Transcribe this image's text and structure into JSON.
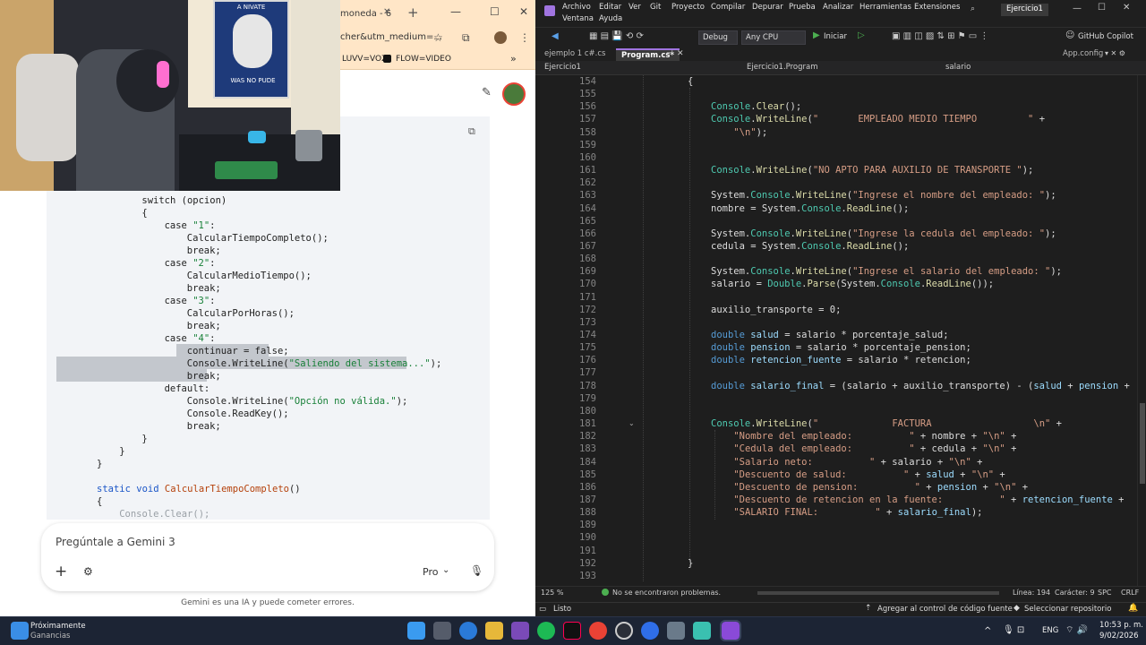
{
  "browser": {
    "tab_title": "moneda - 6",
    "url_fragment": "cher&utm_medium=...",
    "bookmarks": [
      "LUVV=VOZ",
      "FLOW=VIDEO"
    ],
    "gemini": {
      "prompt_placeholder": "Pregúntale a Gemini 3",
      "model_label": "Pro",
      "disclaimer": "Gemini es una IA y puede cometer errores."
    },
    "code_lines": [
      {
        "indent": 8,
        "text": "switch (opcion)"
      },
      {
        "indent": 8,
        "text": "{"
      },
      {
        "indent": 12,
        "text": "case \"1\":"
      },
      {
        "indent": 16,
        "text": "CalcularTiempoCompleto();"
      },
      {
        "indent": 16,
        "text": "break;"
      },
      {
        "indent": 12,
        "text": "case \"2\":"
      },
      {
        "indent": 16,
        "text": "CalcularMedioTiempo();"
      },
      {
        "indent": 16,
        "text": "break;"
      },
      {
        "indent": 12,
        "text": "case \"3\":"
      },
      {
        "indent": 16,
        "text": "CalcularPorHoras();"
      },
      {
        "indent": 16,
        "text": "break;"
      },
      {
        "indent": 12,
        "text": "case \"4\":"
      },
      {
        "indent": 16,
        "text": "continuar = false;"
      },
      {
        "indent": 16,
        "text": "Console.WriteLine(\"Saliendo del sistema...\");"
      },
      {
        "indent": 16,
        "text": "break;"
      },
      {
        "indent": 12,
        "text": "default:"
      },
      {
        "indent": 16,
        "text": "Console.WriteLine(\"Opción no válida.\");"
      },
      {
        "indent": 16,
        "text": "Console.ReadKey();"
      },
      {
        "indent": 16,
        "text": "break;"
      },
      {
        "indent": 8,
        "text": "}"
      },
      {
        "indent": 4,
        "text": "}"
      },
      {
        "indent": 0,
        "text": "}"
      },
      {
        "indent": 0,
        "text": ""
      },
      {
        "indent": 0,
        "text": "static void CalcularTiempoCompleto()"
      },
      {
        "indent": 0,
        "text": "{"
      },
      {
        "indent": 4,
        "text": "Console.Clear();"
      }
    ],
    "webcam_poster_text": [
      "A NIVATE",
      "WAS NO PUDE"
    ]
  },
  "vs": {
    "menu": [
      "Archivo",
      "Editar",
      "Ver",
      "Git",
      "Proyecto",
      "Compilar",
      "Depurar",
      "Prueba",
      "Analizar",
      "Herramientas",
      "Extensiones",
      "Ventana",
      "Ayuda"
    ],
    "solution_name": "Ejercicio1",
    "config": "Debug",
    "platform": "Any CPU",
    "run_label": "Iniciar",
    "copilot_label": "GitHub Copilot",
    "tabs": [
      "ejemplo 1 c#.cs",
      "Program.cs*",
      "App.config"
    ],
    "nav": {
      "project": "Ejercicio1",
      "class": "Ejercicio1.Program",
      "member": "salario"
    },
    "line_numbers": [
      "154",
      "155",
      "156",
      "157",
      "158",
      "159",
      "160",
      "161",
      "162",
      "163",
      "164",
      "165",
      "166",
      "167",
      "168",
      "169",
      "170",
      "171",
      "172",
      "173",
      "174",
      "175",
      "176",
      "177",
      "178",
      "179",
      "180",
      "181",
      "182",
      "183",
      "184",
      "185",
      "186",
      "187",
      "188",
      "189",
      "190",
      "191",
      "192",
      "193"
    ],
    "code": [
      "{",
      "",
      "Console.Clear();",
      "Console.WriteLine(\"       EMPLEADO MEDIO TIEMPO         \" +",
      "    \"\\n\");",
      "",
      "",
      "Console.WriteLine(\"NO APTO PARA AUXILIO DE TRANSPORTE \");",
      "",
      "System.Console.WriteLine(\"Ingrese el nombre del empleado: \");",
      "nombre = System.Console.ReadLine();",
      "",
      "System.Console.WriteLine(\"Ingrese la cedula del empleado: \");",
      "cedula = System.Console.ReadLine();",
      "",
      "System.Console.WriteLine(\"Ingrese el salario del empleado: \");",
      "salario = Double.Parse(System.Console.ReadLine());",
      "",
      "auxilio_transporte = 0;",
      "",
      "double salud = salario * porcentaje_salud;",
      "double pension = salario * porcentaje_pension;",
      "double retencion_fuente = salario * retencion;",
      "",
      "double salario_final = (salario + auxilio_transporte) - (salud + pension +",
      "",
      "",
      "Console.WriteLine(\"             FACTURA                  \\n\" +",
      "    \"Nombre del empleado:          \" + nombre + \"\\n\" +",
      "    \"Cedula del empleado:          \" + cedula + \"\\n\" +",
      "    \"Salario neto:          \" + salario + \"\\n\" +",
      "    \"Descuento de salud:          \" + salud + \"\\n\" +",
      "    \"Descuento de pension:          \" + pension + \"\\n\" +",
      "    \"Descuento de retencion en la fuente:          \" + retencion_fuente +",
      "    \"SALARIO FINAL:          \" + salario_final);",
      "",
      "",
      "",
      "}",
      ""
    ],
    "status_line": {
      "zoom": "125 %",
      "problems": "No se encontraron problemas.",
      "line": "Línea: 194",
      "char": "Carácter: 9",
      "spc": "SPC",
      "crlf": "CRLF"
    },
    "status": {
      "ready": "Listo",
      "source_control": "Agregar al control de código fuente",
      "repo": "Seleccionar repositorio"
    }
  },
  "taskbar": {
    "widget_title": "Próximamente",
    "widget_subtitle": "Ganancias",
    "lang": "ENG",
    "time": "10:53 p. m.",
    "date": "9/02/2026"
  }
}
